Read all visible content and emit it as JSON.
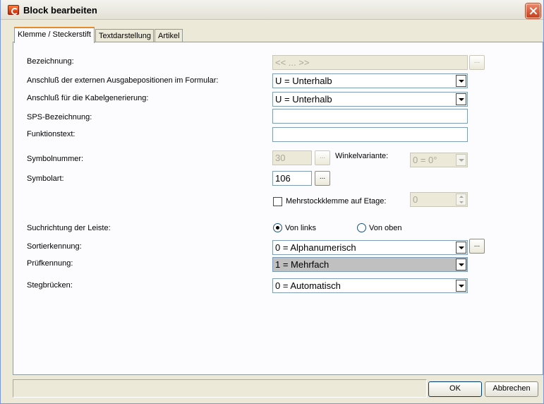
{
  "window": {
    "title": "Block bearbeiten"
  },
  "tabs": [
    {
      "label": "Klemme / Steckerstift",
      "active": true
    },
    {
      "label": "Textdarstellung",
      "active": false
    },
    {
      "label": "Artikel",
      "active": false
    }
  ],
  "form": {
    "bezeichnung": {
      "label": "Bezeichnung:",
      "value": "<< ... >>"
    },
    "anschluss_extern": {
      "label": "Anschluß der externen Ausgabepositionen im Formular:",
      "value": "U = Unterhalb"
    },
    "anschluss_kabel": {
      "label": "Anschluß für die Kabelgenerierung:",
      "value": "U = Unterhalb"
    },
    "sps": {
      "label": "SPS-Bezeichnung:",
      "value": ""
    },
    "funktionstext": {
      "label": "Funktionstext:",
      "value": ""
    },
    "symbolnummer": {
      "label": "Symbolnummer:",
      "value": "30"
    },
    "winkelvariante": {
      "label": "Winkelvariante:",
      "value": "0 = 0°"
    },
    "symbolart": {
      "label": "Symbolart:",
      "value": "106"
    },
    "mehrstock": {
      "label": "Mehrstockklemme auf Etage:",
      "checked": false,
      "value": "0"
    },
    "suchrichtung": {
      "label": "Suchrichtung der Leiste:",
      "options": [
        {
          "label": "Von links",
          "checked": true
        },
        {
          "label": "Von oben",
          "checked": false
        }
      ]
    },
    "sortierkennung": {
      "label": "Sortierkennung:",
      "value": "0 = Alphanumerisch"
    },
    "pruefkennung": {
      "label": "Prüfkennung:",
      "value": "1 = Mehrfach"
    },
    "stegbruecken": {
      "label": "Stegbrücken:",
      "value": "0 = Automatisch"
    },
    "ellipsis": "..."
  },
  "buttons": {
    "ok": "OK",
    "cancel": "Abbrechen"
  }
}
